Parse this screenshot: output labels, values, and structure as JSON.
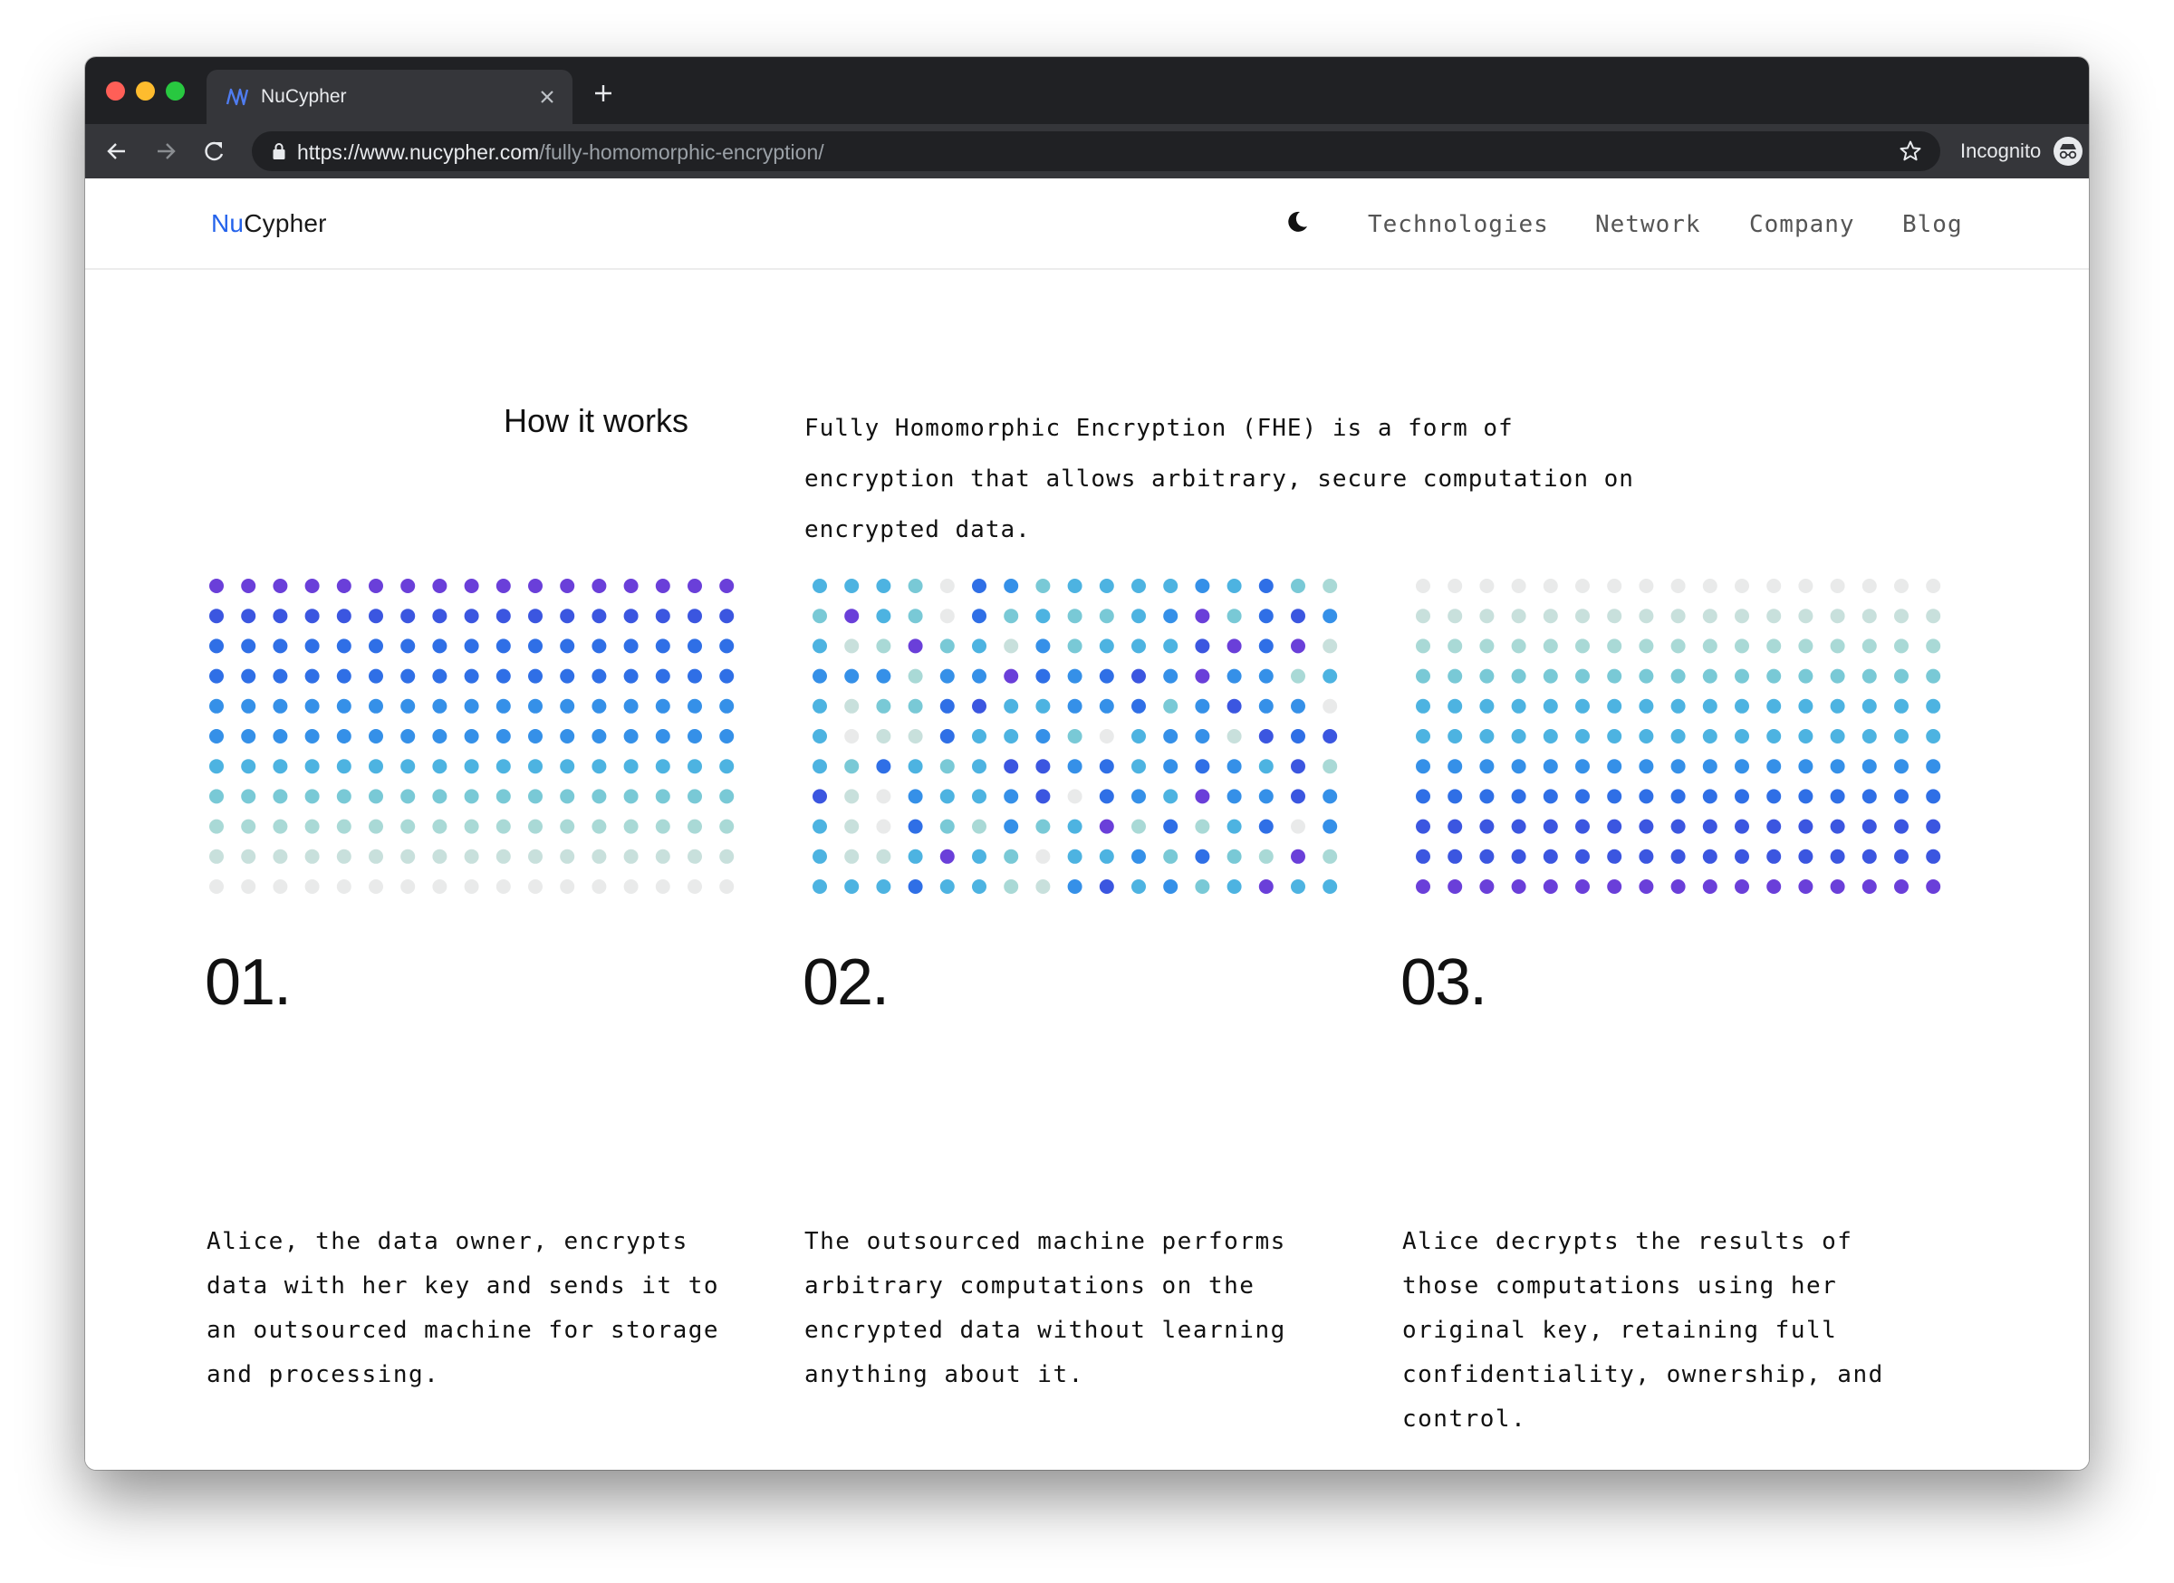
{
  "browser": {
    "tab_title": "NuCypher",
    "url_domain": "https://www.nucypher.com",
    "url_path": "/fully-homomorphic-encryption/",
    "incognito_label": "Incognito"
  },
  "site": {
    "logo_prefix": "Nu",
    "logo_suffix": "Cypher",
    "nav": [
      "Technologies",
      "Network",
      "Company",
      "Blog"
    ]
  },
  "section": {
    "title": "How it works",
    "intro_lines": [
      "Fully Homomorphic Encryption (FHE) is a form of",
      "encryption that allows arbitrary, secure computation on",
      "encrypted data."
    ]
  },
  "steps": [
    {
      "number": "01.",
      "lines": [
        "Alice, the data owner, encrypts",
        "data with her key and sends it to",
        "an outsourced machine for storage",
        "and processing."
      ]
    },
    {
      "number": "02.",
      "lines": [
        "The outsourced machine performs",
        "arbitrary computations on the",
        "encrypted data without learning",
        "anything about it."
      ]
    },
    {
      "number": "03.",
      "lines": [
        "Alice decrypts the results of",
        "those computations using her",
        "original key, retaining full",
        "confidentiality, ownership, and",
        "control."
      ]
    }
  ],
  "colors": {
    "brand_blue": "#2563eb",
    "dot_palette": [
      "#e9eaea",
      "#c8e0dc",
      "#a9d9d6",
      "#79c9d6",
      "#4db3e1",
      "#3590e8",
      "#2f6fe6",
      "#3b56e0",
      "#6a3fd9"
    ]
  },
  "grids": [
    {
      "name": "encrypt-grid",
      "rows": [
        "88888888888888888",
        "77777777777777777",
        "66666666666666666",
        "66666666666666666",
        "55555555555555555",
        "55555555555555555",
        "44444444444444444",
        "33333333333333333",
        "22222222222222222",
        "11111111111111111",
        "00000000000000000"
      ]
    },
    {
      "name": "compute-grid",
      "rows": [
        "44430653444454632",
        "38430634334583675",
        "41283415344478681",
        "55525586567585524",
        "41336744556357550",
        "40116445304551767",
        "43643477564565472",
        "71054457065485575",
        "41063253482624605",
        "41148430445363282",
        "44464421574534844"
      ]
    },
    {
      "name": "decrypt-grid",
      "rows": [
        "00000000000000000",
        "11111111111111111",
        "22222222222222222",
        "33333333333333333",
        "44444444444444444",
        "44444444444444444",
        "55555555555555555",
        "66666666666666666",
        "77777777777777777",
        "77777777777777777",
        "88888888888888888"
      ]
    }
  ]
}
